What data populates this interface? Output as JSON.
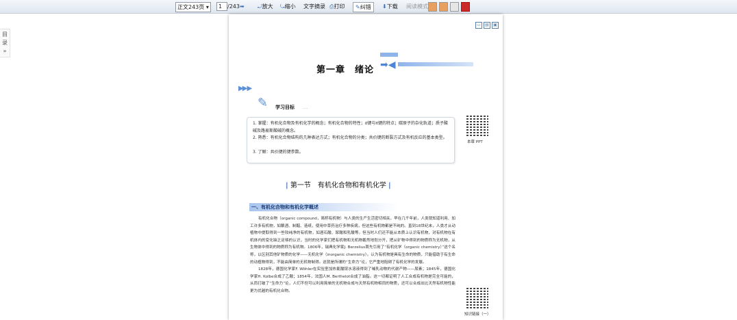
{
  "toolbar": {
    "page_select": "正文243页",
    "page_input": "1",
    "page_total": "/243",
    "zoom_in": "放大",
    "zoom_out": "缩小",
    "text_extract": "文字摘录",
    "print": "打印",
    "correction": "纠错",
    "download": "下载",
    "read_mode": "阅读模式"
  },
  "sidebar": {
    "toc_label": "目录",
    "expand": "»"
  },
  "page": {
    "chapter_title": "第一章　绪论",
    "objectives_label": "学习目标",
    "objectives": [
      "1. 掌握：有机化合物及有机化学的概念；有机化合物的特性；σ键与π键的特点；碳原子的杂化轨道；质子酸碱及路易斯酸碱的概念。",
      "2. 熟悉：有机化合物结构的几种表达方式；有机化合物的分类；共价键的断裂方式及有机反应的基本类型。",
      "3. 了解：共价键的键参数。"
    ],
    "qr1_caption": "本章 PPT",
    "section_title": "第一节　有机化合物和有机化学",
    "subsection_title": "一、有机化合物和有机化学概述",
    "paragraphs": [
      "有机化合物（organic compound，简称有机物）与人类的生产生活密切相关，早在几千年前，人类就知道利用、加工许多有机物，如酿酒、制醋、造纸，使用中草药治疗多种疾病，但这些有机物都是不纯的。直到18世纪末，人类才从动植物中提取得到一些较纯净的有机物，如酒石酸、尿酸和乳酸等。但当时人们还不能从本质上认识有机物，对有机物在有机体内的变化缺乏足够的认识，当时的化学家们把有机物和无机物截然地划分开，把从矿物中得到的物质称为无机物，从生物体中得到的物质称为有机物。1806年，瑞典化学家J. Berzelius首先引用了“有机化学（organic chemistry）”这个名称，以区别其他矿物质的化学——无机化学（inorganic chemistry）。认为有机物是具有生命的物质，只能借助于有生命的动植物得到，不能由简单的无机物制得。这就是所谓的“生命力”论，它严重地阻碍了有机化学的发展。",
      "1828年，德国化学家F. Wöhler在实验室加热氰酸铵水溶液得到了哺乳动物的代谢产物——尿素；1845年，德国化学家H. Kolbe合成了乙酸；1854年，法国人M. Berthelot合成了油脂。这一切都证明了人工合成有机物是完全可能的，从而打破了“生命力”论，人们不但可以利用简单的无机物合成与天然有机物相同的物质，还可以合成出比天然有机物性能更为优越的有机化合物。"
    ],
    "qr2_caption": "知识链接（一）"
  },
  "colors": {
    "accent": "#3a6fb7",
    "heading_bar": "#a9c4ee"
  }
}
